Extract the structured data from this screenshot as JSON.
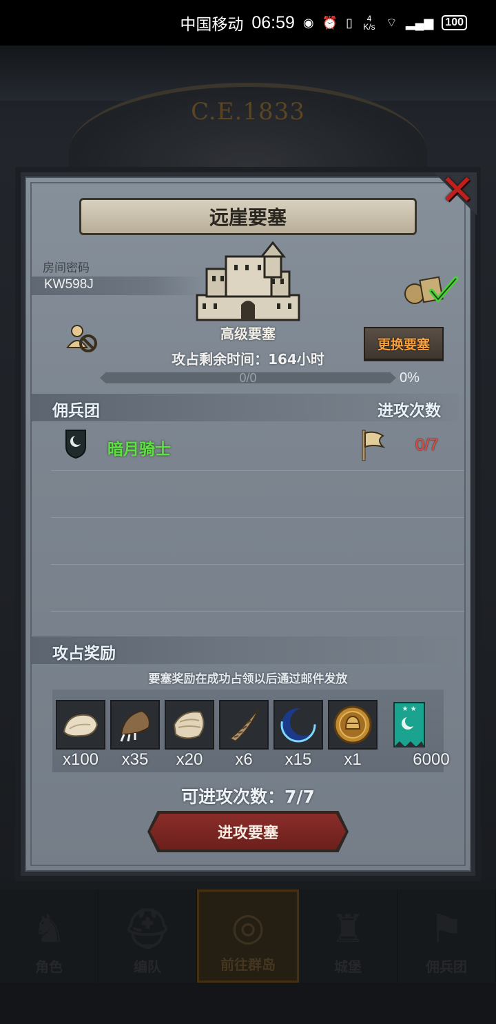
{
  "status_bar": {
    "carrier": "中国移动",
    "time": "06:59",
    "net_speed": "4 K/s",
    "battery": "100"
  },
  "background": {
    "era_text": "C.E.1833",
    "nav": [
      {
        "label": "角色",
        "icon": "knight-icon"
      },
      {
        "label": "编队",
        "icon": "helmet-icon"
      },
      {
        "label": "前往群岛",
        "icon": "compass-icon",
        "active": true
      },
      {
        "label": "城堡",
        "icon": "castle-icon"
      },
      {
        "label": "佣兵团",
        "icon": "banner-icon"
      }
    ]
  },
  "dialog": {
    "title": "远崖要塞",
    "room_label": "房间密码",
    "room_code": "KW598J",
    "fort_type": "高级要塞",
    "change_button": "更换要塞",
    "time_left": "攻占剩余时间：164小时",
    "progress_text": "0/0",
    "progress_percent": "0%",
    "progress_value": 0,
    "mercenary_header": "佣兵团",
    "attack_count_header": "进攻次数",
    "guild": {
      "name": "暗月骑士",
      "attacks": "0/7",
      "icon": "moon-shield-icon"
    },
    "rewards_header": "攻占奖励",
    "rewards_note": "要塞奖励在成功占领以后通过邮件发放",
    "rewards": [
      {
        "icon": "fur-icon",
        "qty": "x100"
      },
      {
        "icon": "claw-icon",
        "qty": "x35"
      },
      {
        "icon": "hide-icon",
        "qty": "x20"
      },
      {
        "icon": "horn-icon",
        "qty": "x6"
      },
      {
        "icon": "crescent-icon",
        "qty": "x15"
      },
      {
        "icon": "helmet-coin-icon",
        "qty": "x1"
      },
      {
        "icon": "guild-banner-icon",
        "qty": "6000"
      }
    ],
    "attempts_text": "可进攻次数：7/7",
    "attack_button": "进攻要塞"
  },
  "colors": {
    "guild_name": "#5de043",
    "attack_count": "#e44b3e",
    "change_button_text": "#f7a040",
    "attack_button": "#7a2623",
    "close": "#c0201c"
  }
}
